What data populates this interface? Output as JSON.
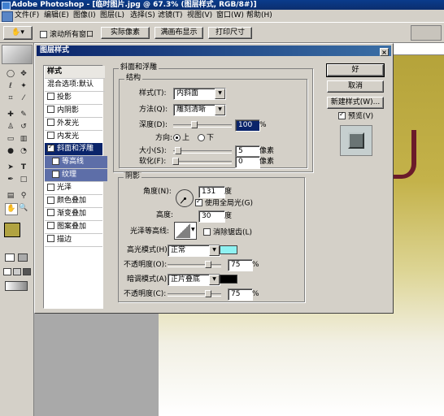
{
  "app": {
    "title": "Adobe Photoshop - [临时图片.jpg @ 67.3% (图层样式, RGB/8#)]"
  },
  "menu": [
    "文件(F)",
    "编辑(E)",
    "图像(I)",
    "图层(L)",
    "选择(S)",
    "滤镜(T)",
    "视图(V)",
    "窗口(W)",
    "帮助(H)"
  ],
  "options": {
    "scroll_all_label": "滚动所有窗口",
    "actual_pixels": "实际像素",
    "fit_screen": "满画布显示",
    "print_size": "打印尺寸"
  },
  "dialog": {
    "title": "图层样式",
    "close_glyph": "×",
    "styles": [
      {
        "label": "样式",
        "checkbox": false,
        "checked": false,
        "state": "header"
      },
      {
        "label": "混合选项:默认",
        "checkbox": false,
        "checked": false,
        "state": "normal"
      },
      {
        "label": "投影",
        "checkbox": true,
        "checked": false,
        "state": "normal"
      },
      {
        "label": "内阴影",
        "checkbox": true,
        "checked": false,
        "state": "normal"
      },
      {
        "label": "外发光",
        "checkbox": true,
        "checked": false,
        "state": "normal"
      },
      {
        "label": "内发光",
        "checkbox": true,
        "checked": false,
        "state": "normal"
      },
      {
        "label": "斜面和浮雕",
        "checkbox": true,
        "checked": true,
        "state": "selected"
      },
      {
        "label": "等高线",
        "checkbox": true,
        "checked": false,
        "state": "sub"
      },
      {
        "label": "纹理",
        "checkbox": true,
        "checked": false,
        "state": "sub"
      },
      {
        "label": "光泽",
        "checkbox": true,
        "checked": false,
        "state": "normal"
      },
      {
        "label": "颜色叠加",
        "checkbox": true,
        "checked": false,
        "state": "normal"
      },
      {
        "label": "渐变叠加",
        "checkbox": true,
        "checked": false,
        "state": "normal"
      },
      {
        "label": "图案叠加",
        "checkbox": true,
        "checked": false,
        "state": "normal"
      },
      {
        "label": "描边",
        "checkbox": true,
        "checked": false,
        "state": "normal"
      }
    ],
    "bevel": {
      "section_title": "斜面和浮雕",
      "structure_title": "结构",
      "style_label": "样式(T):",
      "style_value": "内斜面",
      "technique_label": "方法(Q):",
      "technique_value": "雕刻清晰",
      "depth_label": "深度(D):",
      "depth_value": "100",
      "depth_unit": "%",
      "direction_label": "方向:",
      "direction_up": "上",
      "direction_down": "下",
      "size_label": "大小(S):",
      "size_value": "5",
      "size_unit": "像素",
      "soften_label": "软化(F):",
      "soften_value": "0",
      "soften_unit": "像素"
    },
    "shading": {
      "title": "阴影",
      "angle_label": "角度(N):",
      "angle_value": "131",
      "angle_unit": "度",
      "global_light_label": "使用全局光(G)",
      "altitude_label": "高度:",
      "altitude_value": "30",
      "altitude_unit": "度",
      "gloss_label": "光泽等高线:",
      "antialias_label": "消除锯齿(L)",
      "highlight_label": "高光模式(H):",
      "highlight_mode": "正常",
      "highlight_color": "#8ff2f2",
      "hl_opacity_label": "不透明度(O):",
      "hl_opacity_value": "75",
      "hl_opacity_unit": "%",
      "shadow_label": "暗调模式(A):",
      "shadow_mode": "正片叠底",
      "shadow_color": "#000000",
      "sh_opacity_label": "不透明度(C):",
      "sh_opacity_value": "75",
      "sh_opacity_unit": "%"
    },
    "buttons": {
      "ok": "好",
      "cancel": "取消",
      "new_style": "新建样式(W)...",
      "preview": "预览(V)"
    }
  }
}
